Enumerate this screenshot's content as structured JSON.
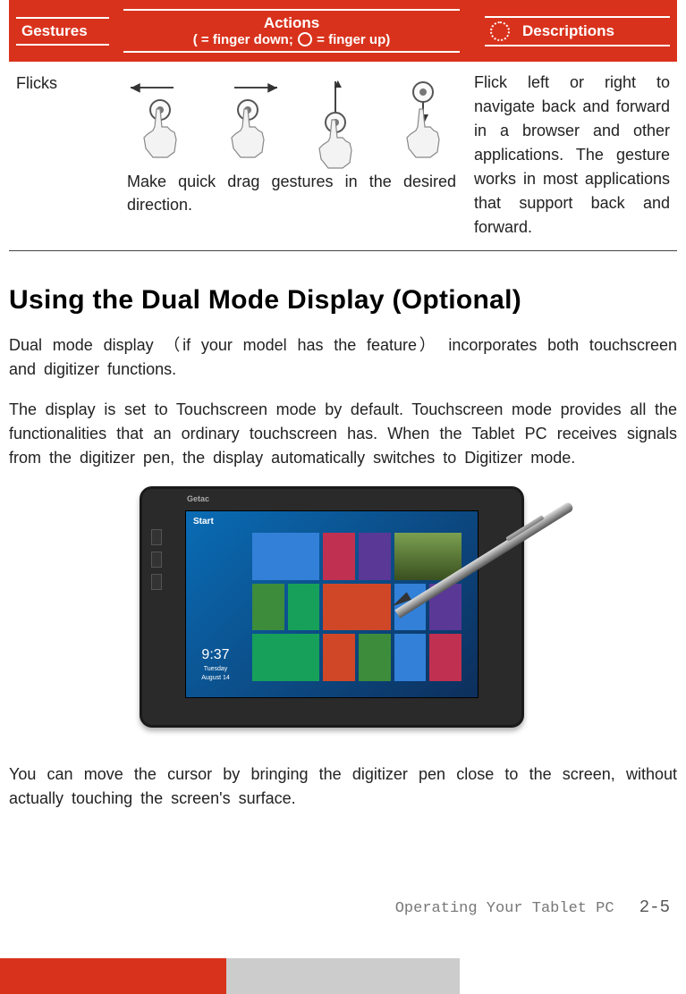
{
  "table": {
    "headers": {
      "gestures": "Gestures",
      "actions_line1": "Actions",
      "actions_line2_prefix": "(",
      "actions_line2_mid": " = finger down; ",
      "actions_line2_suffix": "= finger up)",
      "descriptions": "Descriptions"
    },
    "row": {
      "gesture": "Flicks",
      "action_caption": "Make quick drag gestures in the desired direction.",
      "description": "Flick left or right to navigate back and forward in a browser and other applications. The gesture works in most applications that support back and forward."
    }
  },
  "section": {
    "heading": "Using the Dual Mode Display (Optional)",
    "para1": "Dual mode display （if your model has the feature） incorporates both touchscreen and digitizer functions.",
    "para2": "The display is set to Touchscreen mode by default. Touchscreen mode provides all the functionalities that an ordinary touchscreen has. When the Tablet PC receives signals from the digitizer pen, the display automatically switches to Digitizer mode.",
    "para3": "You can move the cursor by bringing the digitizer pen close to the screen, without actually touching the screen's surface."
  },
  "tablet": {
    "brand": "Getac",
    "screen_label": "Start",
    "time": "9:37",
    "day": "Tuesday",
    "date": "August 14"
  },
  "footer": {
    "text": "Operating Your Tablet PC",
    "page": "2-5"
  }
}
